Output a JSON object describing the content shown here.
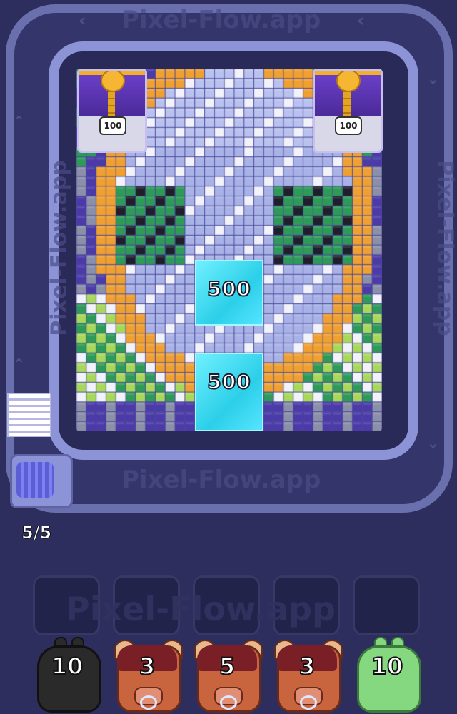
{
  "watermark": "Pixel-Flow.app",
  "board": {
    "cols": 31,
    "rows": 37,
    "locks": [
      {
        "side": "left",
        "value": "100"
      },
      {
        "side": "right",
        "value": "100"
      }
    ],
    "ice_blocks": [
      {
        "label": "500"
      },
      {
        "label": "500"
      }
    ]
  },
  "launcher": {
    "ammo": "5/5"
  },
  "slots": [
    {
      "state": "empty"
    },
    {
      "state": "empty"
    },
    {
      "state": "empty"
    },
    {
      "state": "empty"
    },
    {
      "state": "empty"
    }
  ],
  "units": [
    {
      "type": "black-slime",
      "value": "10",
      "color": "#2a2a2a"
    },
    {
      "type": "bull",
      "value": "3",
      "color": "#c8653f"
    },
    {
      "type": "bull",
      "value": "5",
      "color": "#c8653f"
    },
    {
      "type": "bull",
      "value": "3",
      "color": "#c8653f"
    },
    {
      "type": "green-slime",
      "value": "10",
      "color": "#86d880"
    }
  ],
  "colors": {
    "background": "#2d2e5e",
    "track": "#8c93d6",
    "ice": "#38d7f0",
    "orange": "#f0a030",
    "purple": "#4b3aa8",
    "green": "#2e9a58",
    "lime": "#a8d85a",
    "white": "#f2f2fb",
    "grey": "#8b8fa8",
    "black": "#1f1f2c"
  }
}
